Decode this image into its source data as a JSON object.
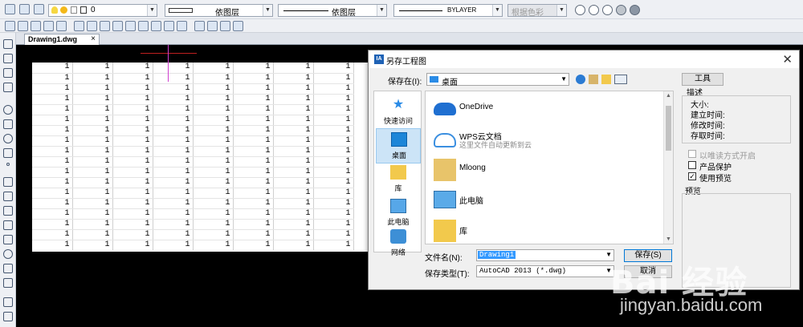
{
  "toolbar": {
    "layer_value": "0",
    "linetype_by": "依图层",
    "lineweight_by": "依图层",
    "linestyle_by": "BYLAYER",
    "color_mode": "根据色彩"
  },
  "document_tab": {
    "label": "Drawing1.dwg",
    "close": "×"
  },
  "sheet": {
    "rows": 18,
    "cols": 8,
    "cell_value": "1"
  },
  "dialog": {
    "title": "另存工程图",
    "close": "✕",
    "save_in_label": "保存在(I):",
    "save_in_value": "桌面",
    "tools_button": "工具",
    "places": [
      {
        "label": "快速访问",
        "icon": "quick-access-icon"
      },
      {
        "label": "桌面",
        "icon": "desktop-icon"
      },
      {
        "label": "库",
        "icon": "library-icon"
      },
      {
        "label": "此电脑",
        "icon": "this-pc-icon"
      },
      {
        "label": "网络",
        "icon": "network-icon"
      }
    ],
    "files": [
      {
        "name": "OneDrive",
        "sub": "",
        "icon": "onedrive-icon"
      },
      {
        "name": "WPS云文档",
        "sub": "这里文件自动更新到云",
        "icon": "wps-cloud-icon"
      },
      {
        "name": "Mloong",
        "sub": "",
        "icon": "user-folder-icon"
      },
      {
        "name": "此电脑",
        "sub": "",
        "icon": "computer-icon"
      },
      {
        "name": "库",
        "sub": "",
        "icon": "library-folder-icon"
      }
    ],
    "description_title": "描述",
    "description_fields": [
      "大小:",
      "建立时间:",
      "修改时间:",
      "存取时间:"
    ],
    "readonly_label": "以唯读方式开启",
    "product_protect_label": "产品保护",
    "use_preview_label": "使用预览",
    "use_preview_check": "✓",
    "preview_title": "预览",
    "filename_label": "文件名(N):",
    "filename_value": "Drawing1",
    "filetype_label": "保存类型(T):",
    "filetype_value": "AutoCAD 2013 (*.dwg)",
    "save_button": "保存(S)",
    "cancel_button": "取消"
  },
  "watermark": {
    "logo": "Bai 经验",
    "url": "jingyan.baidu.com"
  }
}
